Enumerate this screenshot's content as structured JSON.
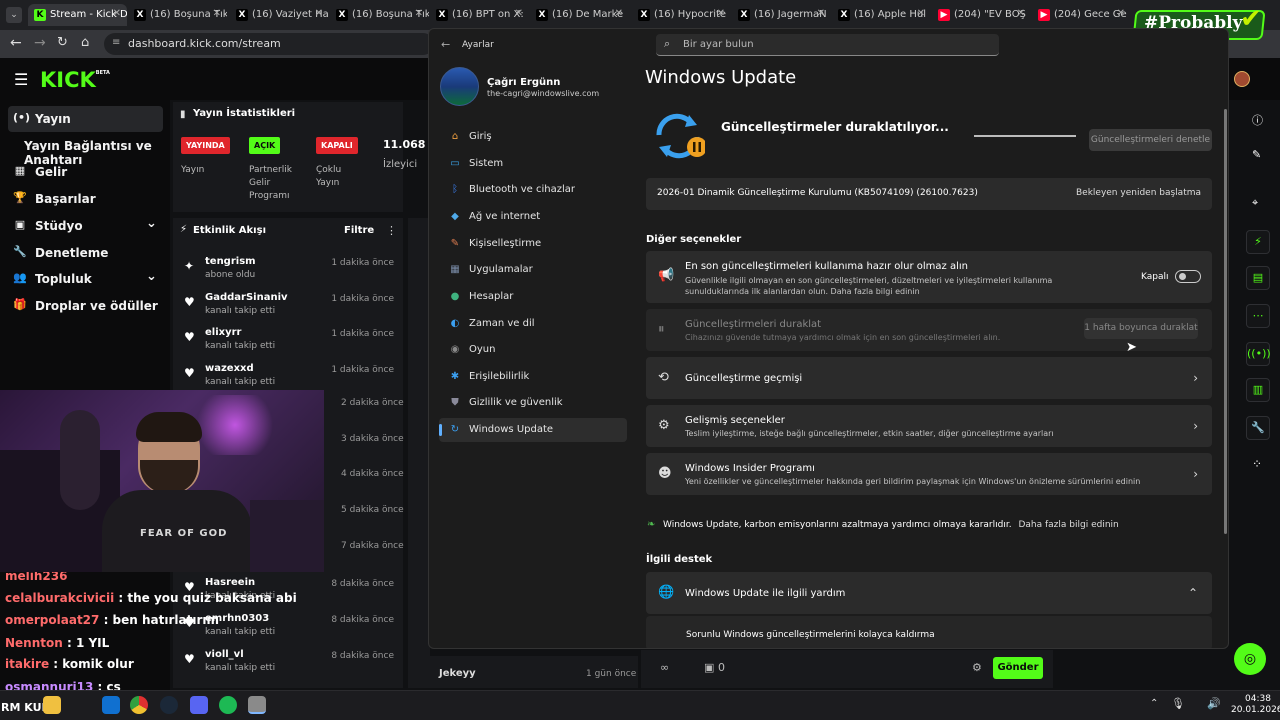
{
  "browser": {
    "tabs": [
      {
        "label": "Stream - Kick D",
        "fav": "K",
        "color": "#53fc18",
        "active": true
      },
      {
        "label": "(16) Boşuna Tık",
        "fav": "X",
        "color": "#000000"
      },
      {
        "label": "(16) Vaziyet Ha",
        "fav": "X",
        "color": "#000000"
      },
      {
        "label": "(16) Boşuna Tık",
        "fav": "X",
        "color": "#000000"
      },
      {
        "label": "(16) BPT on X:",
        "fav": "X",
        "color": "#000000"
      },
      {
        "label": "(16) De Marke",
        "fav": "X",
        "color": "#000000"
      },
      {
        "label": "(16) Hypocrite",
        "fav": "X",
        "color": "#000000"
      },
      {
        "label": "(16) JagermaN",
        "fav": "X",
        "color": "#000000"
      },
      {
        "label": "(16) Apple Hul",
        "fav": "X",
        "color": "#000000"
      },
      {
        "label": "(204) \"EV BOŞ",
        "fav": "▶",
        "color": "#ff0033"
      },
      {
        "label": "(204) Gece Ge",
        "fav": "▶",
        "color": "#ff0033"
      }
    ],
    "url": "dashboard.kick.com/stream"
  },
  "overlay": {
    "hashtag": "#Probably"
  },
  "kick": {
    "logo": "KICK",
    "logo_beta": "BETA",
    "nav": [
      {
        "label": "Yayın",
        "icon": "(•)",
        "sel": true
      },
      {
        "label": "Yayın Bağlantısı ve Anahtarı",
        "icon": ""
      },
      {
        "label": "Gelir",
        "icon": "▦"
      },
      {
        "label": "Başarılar",
        "icon": "🏆"
      },
      {
        "label": "Stüdyo",
        "icon": "▣",
        "chev": true
      },
      {
        "label": "Denetleme",
        "icon": "🔧"
      },
      {
        "label": "Topluluk",
        "icon": "👥",
        "chev": true
      },
      {
        "label": "Droplar ve ödüller",
        "icon": "🎁"
      }
    ],
    "stats_title": "Yayın İstatistikleri",
    "stats": [
      {
        "badge": "YAYINDA",
        "bg": "#e0262c",
        "fg": "#ffffff",
        "label": "Yayın"
      },
      {
        "badge": "AÇIK",
        "bg": "#53fc18",
        "fg": "#0b0b0c",
        "label": "Partnerlik Gelir Programı"
      },
      {
        "badge": "KAPALI",
        "bg": "#e0262c",
        "fg": "#ffffff",
        "label": "Çoklu Yayın"
      }
    ],
    "viewers": "11.068",
    "viewers_label": "İzleyici",
    "activity_title": "Etkinlik Akışı",
    "filter": "Filtre",
    "events": [
      {
        "name": "tengrism",
        "sub": "abone oldu",
        "time": "1 dakika önce",
        "icon": "✦"
      },
      {
        "name": "GaddarSinaniv",
        "sub": "kanalı takip etti",
        "time": "1 dakika önce",
        "icon": "♥"
      },
      {
        "name": "elixyrr",
        "sub": "kanalı takip etti",
        "time": "1 dakika önce",
        "icon": "♥"
      },
      {
        "name": "wazexxd",
        "sub": "kanalı takip etti",
        "time": "1 dakika önce",
        "icon": "♥"
      }
    ],
    "hidden_times": [
      "2 dakika önce",
      "3 dakika önce",
      "4 dakika önce",
      "5 dakika önce",
      "7 dakika önce"
    ],
    "events2": [
      {
        "name": "Hasreein",
        "sub": "kanalı takip etti",
        "time": "8 dakika önce",
        "icon": "♥"
      },
      {
        "name": "emrhn0303",
        "sub": "kanalı takip etti",
        "time": "8 dakika önce",
        "icon": "♥"
      },
      {
        "name": "violl_vl",
        "sub": "kanalı takip etti",
        "time": "8 dakika önce",
        "icon": "♥"
      }
    ],
    "chat": [
      {
        "user": "melih236",
        "msg": "",
        "color": "#ff6b6b"
      },
      {
        "user": "celalburakcivicii",
        "msg": " : the you quiz baksana abi",
        "color": "#ff6b6b"
      },
      {
        "user": "omerpolaat27",
        "msg": " : ben hatırlatırım",
        "color": "#ff6b6b"
      },
      {
        "user": "Nennton",
        "msg": " : 1 YIL",
        "color": "#ff6b6b"
      },
      {
        "user": "itakire",
        "msg": " : komik olur",
        "color": "#ff6b6b"
      },
      {
        "user": "osmannuri13",
        "msg": " : cs",
        "color": "#c78bff"
      }
    ],
    "bottom_user": "Jekeyy",
    "bottom_time": "1 gün önce",
    "send": "Gönder",
    "cam_text": "FEAR OF GOD"
  },
  "settings": {
    "back_label": "Ayarlar",
    "search_placeholder": "Bir ayar bulun",
    "user_name": "Çağrı Ergünn",
    "user_email": "the-cagri@windowslive.com",
    "nav": [
      {
        "label": "Giriş",
        "icon": "⌂",
        "color": "#f0a040"
      },
      {
        "label": "Sistem",
        "icon": "▭",
        "color": "#3ba4e8"
      },
      {
        "label": "Bluetooth ve cihazlar",
        "icon": "ᛒ",
        "color": "#3b7ff0"
      },
      {
        "label": "Ağ ve internet",
        "icon": "◆",
        "color": "#4fa9e8"
      },
      {
        "label": "Kişiselleştirme",
        "icon": "✎",
        "color": "#e07d50"
      },
      {
        "label": "Uygulamalar",
        "icon": "▦",
        "color": "#7a8ca8"
      },
      {
        "label": "Hesaplar",
        "icon": "●",
        "color": "#3fb27f"
      },
      {
        "label": "Zaman ve dil",
        "icon": "◐",
        "color": "#3b9ff0"
      },
      {
        "label": "Oyun",
        "icon": "◉",
        "color": "#8a8a8a"
      },
      {
        "label": "Erişilebilirlik",
        "icon": "✱",
        "color": "#3b9ff0"
      },
      {
        "label": "Gizlilik ve güvenlik",
        "icon": "⛊",
        "color": "#8a8a9a"
      },
      {
        "label": "Windows Update",
        "icon": "↻",
        "color": "#3b9ff0",
        "sel": true
      }
    ],
    "page_title": "Windows Update",
    "status": "Güncelleştirmeler duraklatılıyor...",
    "check_button": "Güncelleştirmeleri denetle",
    "pending_update": "2026-01 Dinamik Güncelleştirme Kurulumu (KB5074109) (26100.7623)",
    "pending_status": "Bekleyen yeniden başlatma",
    "other_options": "Diğer seçenekler",
    "latest": {
      "title": "En son güncelleştirmeleri kullanıma hazır olur olmaz alın",
      "desc": "Güvenlikle ilgili olmayan en son güncelleştirmeleri, düzeltmeleri ve iyileştirmeleri kullanıma sunulduklarında ilk alanlardan olun. Daha fazla bilgi edinin",
      "toggle_label": "Kapalı"
    },
    "pause": {
      "title": "Güncelleştirmeleri duraklat",
      "desc": "Cihazınızı güvende tutmaya yardımcı olmak için en son güncelleştirmeleri alın.",
      "button": "1 hafta boyunca duraklat"
    },
    "history": {
      "title": "Güncelleştirme geçmişi"
    },
    "advanced": {
      "title": "Gelişmiş seçenekler",
      "desc": "Teslim iyileştirme, isteğe bağlı güncelleştirmeler, etkin saatler, diğer güncelleştirme ayarları"
    },
    "insider": {
      "title": "Windows Insider Programı",
      "desc": "Yeni özellikler ve güncelleştirmeler hakkında geri bildirim paylaşmak için Windows'un önizleme sürümlerini edinin"
    },
    "carbon": "Windows Update, karbon emisyonlarını azaltmaya yardımcı olmaya kararlıdır.",
    "carbon_link": "Daha fazla bilgi edinin",
    "related": "İlgili destek",
    "help": {
      "title": "Windows Update ile ilgili yardım",
      "link": "Sorunlu Windows güncelleştirmelerini kolayca kaldırma"
    }
  },
  "taskbar": {
    "left_text": "RM KUR",
    "time": "04:38",
    "date": "20.01.2026"
  }
}
